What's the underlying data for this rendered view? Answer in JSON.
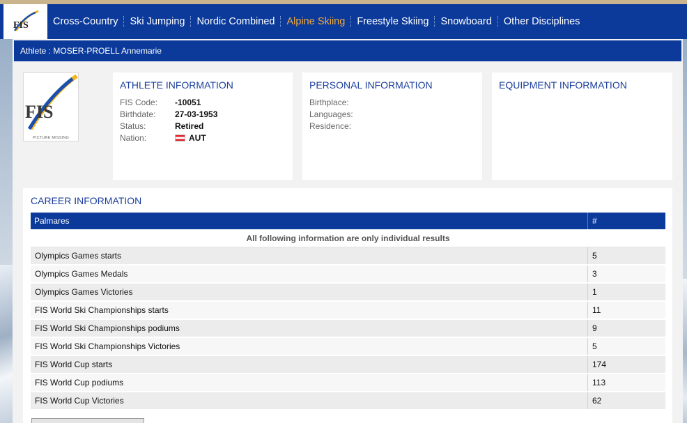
{
  "nav": {
    "logo_text": "FIS",
    "items": [
      {
        "label": "Cross-Country"
      },
      {
        "label": "Ski Jumping"
      },
      {
        "label": "Nordic Combined"
      },
      {
        "label": "Alpine Skiing",
        "active": true
      },
      {
        "label": "Freestyle Skiing"
      },
      {
        "label": "Snowboard"
      },
      {
        "label": "Other Disciplines"
      }
    ],
    "active_color": "#f0a93a",
    "bg_color": "#0b3a9b"
  },
  "athlete_bar": {
    "text": "Athlete : MOSER-PROELL Annemarie"
  },
  "photo": {
    "logo_text": "FIS",
    "caption": "PICTURE MISSING"
  },
  "athlete_info": {
    "title": "ATHLETE INFORMATION",
    "fis_code_label": "FIS Code:",
    "fis_code": "-10051",
    "birthdate_label": "Birthdate:",
    "birthdate": "27-03-1953",
    "status_label": "Status:",
    "status": "Retired",
    "nation_label": "Nation:",
    "nation": "AUT",
    "nation_flag_icon": "austria-flag-icon"
  },
  "personal_info": {
    "title": "PERSONAL INFORMATION",
    "birthplace_label": "Birthplace:",
    "languages_label": "Languages:",
    "residence_label": "Residence:"
  },
  "equipment_info": {
    "title": "EQUIPMENT INFORMATION"
  },
  "career": {
    "title": "CAREER INFORMATION",
    "header": {
      "name": "Palmares",
      "count": "#"
    },
    "note": "All following information are only individual results",
    "rows": [
      {
        "name": "Olympics Games starts",
        "count": "5"
      },
      {
        "name": "Olympics Games Medals",
        "count": "3"
      },
      {
        "name": "Olympics Games Victories",
        "count": "1"
      },
      {
        "name": "FIS World Ski Championships starts",
        "count": "11"
      },
      {
        "name": "FIS World Ski Championships podiums",
        "count": "9"
      },
      {
        "name": "FIS World Ski Championships Victories",
        "count": "5"
      },
      {
        "name": "FIS World Cup starts",
        "count": "174"
      },
      {
        "name": "FIS World Cup podiums",
        "count": "113"
      },
      {
        "name": "FIS World Cup Victories",
        "count": "62"
      }
    ],
    "footer_note": ""
  }
}
